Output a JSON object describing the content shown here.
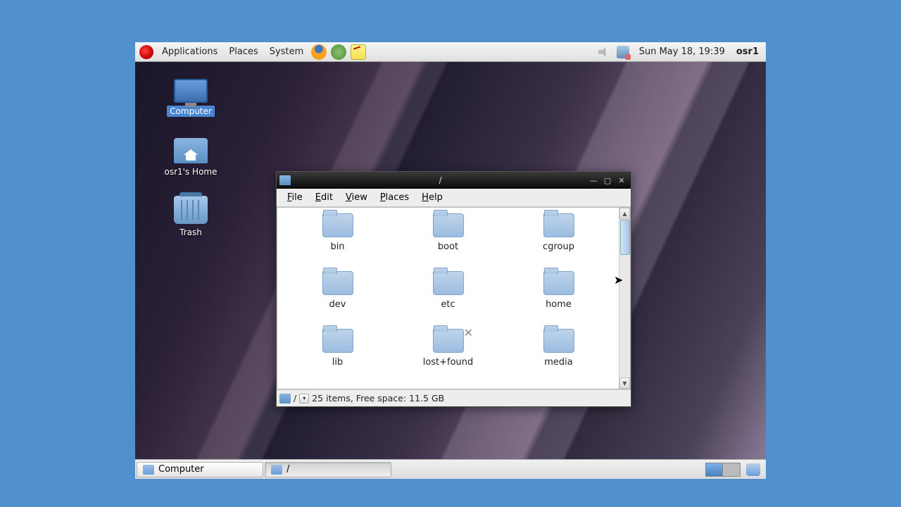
{
  "panel": {
    "menus": {
      "apps": "Applications",
      "places": "Places",
      "system": "System"
    },
    "clock": "Sun May 18, 19:39",
    "user": "osr1"
  },
  "desktop_icons": {
    "computer": "Computer",
    "home": "osr1's Home",
    "trash": "Trash"
  },
  "filemanager": {
    "title": "/",
    "menus": {
      "file": "File",
      "edit": "Edit",
      "view": "View",
      "places": "Places",
      "help": "Help"
    },
    "folders": [
      "bin",
      "boot",
      "cgroup",
      "dev",
      "etc",
      "home",
      "lib",
      "lost+found",
      "media"
    ],
    "status_path": "/",
    "status_text": "25 items, Free space: 11.5 GB"
  },
  "taskbar": {
    "task1": "Computer",
    "task2": "/"
  }
}
